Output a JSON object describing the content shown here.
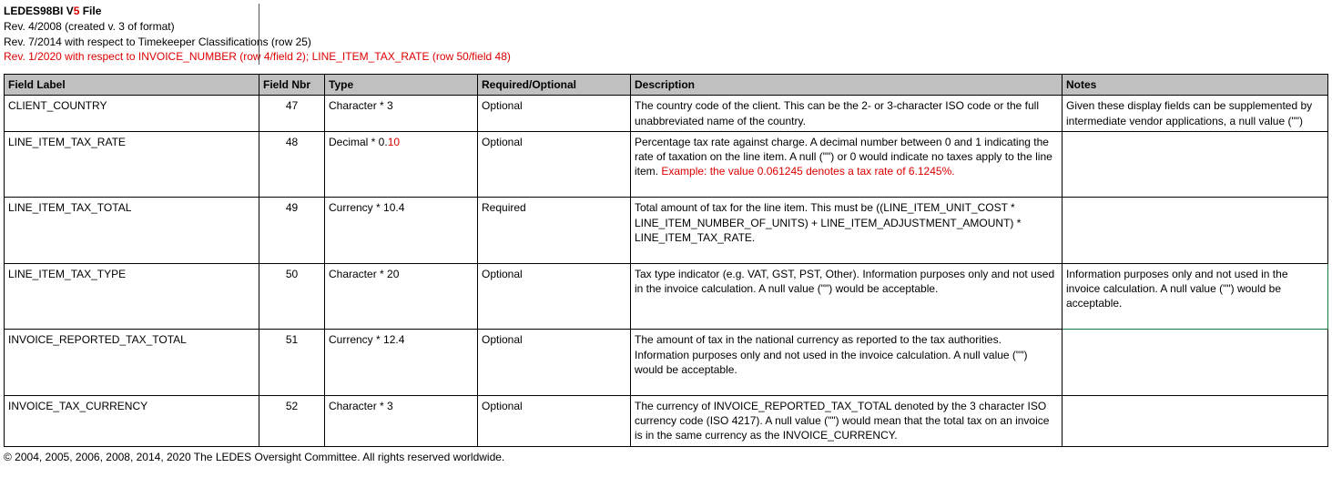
{
  "header": {
    "title_part1": "LEDES98BI V",
    "title_v": "5",
    "title_part2": " File",
    "rev1": "Rev. 4/2008 (created v. 3  of format)",
    "rev2": "Rev. 7/2014 with respect to Timekeeper Classifications (row 25)",
    "rev3": "Rev. 1/2020 with respect to INVOICE_NUMBER (row 4/field 2); LINE_ITEM_TAX_RATE (row 50/field 48)"
  },
  "columns": {
    "label": "Field Label",
    "nbr": "Field Nbr",
    "type": "Type",
    "req": "Required/Optional",
    "desc": "Description",
    "notes": "Notes"
  },
  "rows": [
    {
      "label": "CLIENT_COUNTRY",
      "nbr": "47",
      "type": "Character * 3",
      "req": "Optional",
      "desc": "The country code of the client.   This can be the 2- or 3-character ISO code or the full unabbreviated name of the country.",
      "notes": "Given these display fields can be supplemented by intermediate vendor applications, a null value (\"\")"
    },
    {
      "label": "LINE_ITEM_TAX_RATE",
      "nbr": "48",
      "type_pre": "Decimal * 0.",
      "type_red": "10",
      "req": "Optional",
      "desc_pre": "Percentage tax rate against charge. A decimal number between 0 and 1 indicating the rate of taxation on the line item.  A null (\"\") or 0 would indicate no taxes apply to the line item.  ",
      "desc_red": "Example:  the value 0.061245 denotes a tax rate of 6.1245%.",
      "notes": ""
    },
    {
      "label": "LINE_ITEM_TAX_TOTAL",
      "nbr": "49",
      "type": "Currency * 10.4",
      "req": "Required",
      "desc": "Total amount of tax for the line item. This must be ((LINE_ITEM_UNIT_COST * LINE_ITEM_NUMBER_OF_UNITS) + LINE_ITEM_ADJUSTMENT_AMOUNT) * LINE_ITEM_TAX_RATE.",
      "notes": ""
    },
    {
      "label": "LINE_ITEM_TAX_TYPE",
      "nbr": "50",
      "type": "Character * 20",
      "req": "Optional",
      "desc": "Tax type indicator (e.g. VAT, GST, PST, Other).  Information purposes only and not used in the invoice calculation.  A null value (\"\") would be acceptable.",
      "notes": "Information purposes only and not used in the invoice calculation.  A null value (\"\") would be acceptable.",
      "greenNotes": true
    },
    {
      "label": "INVOICE_REPORTED_TAX_TOTAL",
      "nbr": "51",
      "type": "Currency * 12.4",
      "req": "Optional",
      "desc": "The amount of tax in the national currency as reported to the tax authorities. Information purposes only and not used in the invoice calculation. A null value (\"\") would be acceptable.",
      "notes": ""
    },
    {
      "label": "INVOICE_TAX_CURRENCY",
      "nbr": "52",
      "type": "Character * 3",
      "req": "Optional",
      "desc": "The currency of INVOICE_REPORTED_TAX_TOTAL  denoted by the 3 character ISO currency code (ISO 4217). A null value (\"\") would mean that the total tax on an invoice is in the same currency as the INVOICE_CURRENCY.",
      "notes": ""
    }
  ],
  "footer": "© 2004, 2005, 2006, 2008, 2014, 2020 The LEDES Oversight Committee.  All rights reserved worldwide."
}
